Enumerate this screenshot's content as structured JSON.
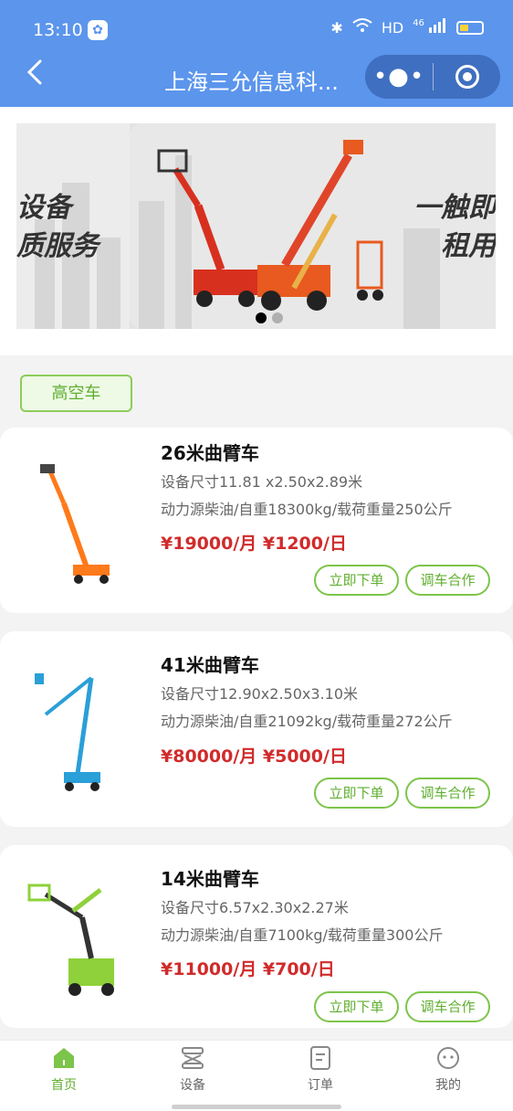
{
  "status_bar": {
    "time": "13:10",
    "hd": "HD",
    "signal": "46"
  },
  "nav": {
    "title": "上海三允信息科...",
    "more_icon": "more-dots-icon",
    "close_icon": "target-close-icon"
  },
  "banner": {
    "left_text_1": "设备",
    "left_text_2": "质服务",
    "right_text_1": "一触即",
    "right_text_2": "租用",
    "active_index": 0
  },
  "category": {
    "label": "高空车"
  },
  "products": [
    {
      "name": "26米曲臂车",
      "size": "设备尺寸11.81 x2.50x2.89米",
      "spec": "动力源柴油/自重18300kg/载荷重量250公斤",
      "price": "¥19000/月 ¥1200/日",
      "order_label": "立即下单",
      "coop_label": "调车合作",
      "color": "#ff7a1a"
    },
    {
      "name": "41米曲臂车",
      "size": "设备尺寸12.90x2.50x3.10米",
      "spec": "动力源柴油/自重21092kg/载荷重量272公斤",
      "price": "¥80000/月 ¥5000/日",
      "order_label": "立即下单",
      "coop_label": "调车合作",
      "color": "#2a9fd8"
    },
    {
      "name": "14米曲臂车",
      "size": "设备尺寸6.57x2.30x2.27米",
      "spec": "动力源柴油/自重7100kg/载荷重量300公斤",
      "price": "¥11000/月 ¥700/日",
      "order_label": "立即下单",
      "coop_label": "调车合作",
      "color": "#8ed13a"
    }
  ],
  "tabbar": {
    "items": [
      {
        "label": "首页",
        "icon": "home-icon",
        "active": true
      },
      {
        "label": "设备",
        "icon": "equipment-icon",
        "active": false
      },
      {
        "label": "订单",
        "icon": "order-icon",
        "active": false
      },
      {
        "label": "我的",
        "icon": "profile-icon",
        "active": false
      }
    ]
  },
  "colors": {
    "header": "#5b95ec",
    "accent_green": "#5fae2e",
    "price_red": "#d12b2b"
  }
}
